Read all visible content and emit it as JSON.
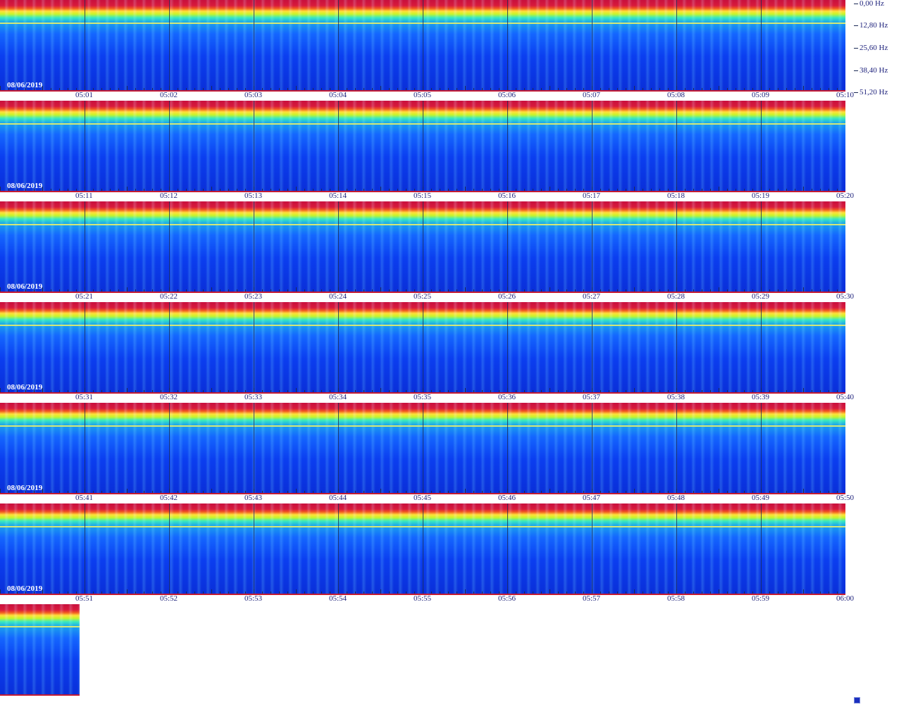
{
  "chart_data": {
    "type": "heatmap",
    "date_label": "08/06/2019",
    "frequency_axis": {
      "labels": [
        "0,00 Hz",
        "12,80 Hz",
        "25,60 Hz",
        "38,40 Hz",
        "51,20 Hz"
      ],
      "values": [
        0.0,
        12.8,
        25.6,
        38.4,
        51.2
      ],
      "unit": "Hz"
    },
    "rows": [
      {
        "date": "08/06/2019",
        "time_labels": [
          "05:01",
          "05:02",
          "05:03",
          "05:04",
          "05:05",
          "05:06",
          "05:07",
          "05:08",
          "05:09",
          "05:10"
        ]
      },
      {
        "date": "08/06/2019",
        "time_labels": [
          "05:11",
          "05:12",
          "05:13",
          "05:14",
          "05:15",
          "05:16",
          "05:17",
          "05:18",
          "05:19",
          "05:20"
        ]
      },
      {
        "date": "08/06/2019",
        "time_labels": [
          "05:21",
          "05:22",
          "05:23",
          "05:24",
          "05:25",
          "05:26",
          "05:27",
          "05:28",
          "05:29",
          "05:30"
        ]
      },
      {
        "date": "08/06/2019",
        "time_labels": [
          "05:31",
          "05:32",
          "05:33",
          "05:34",
          "05:35",
          "05:36",
          "05:37",
          "05:38",
          "05:39",
          "05:40"
        ]
      },
      {
        "date": "08/06/2019",
        "time_labels": [
          "05:41",
          "05:42",
          "05:43",
          "05:44",
          "05:45",
          "05:46",
          "05:47",
          "05:48",
          "05:49",
          "05:50"
        ]
      },
      {
        "date": "08/06/2019",
        "time_labels": [
          "05:51",
          "05:52",
          "05:53",
          "05:54",
          "05:55",
          "05:56",
          "05:57",
          "05:58",
          "05:59",
          "06:00"
        ]
      }
    ],
    "colormap": [
      "#c8103e",
      "#f25a20",
      "#ffe03a",
      "#c8f52a",
      "#38e8c0",
      "#1aa0ee",
      "#1466ff",
      "#0a2fd9"
    ]
  }
}
